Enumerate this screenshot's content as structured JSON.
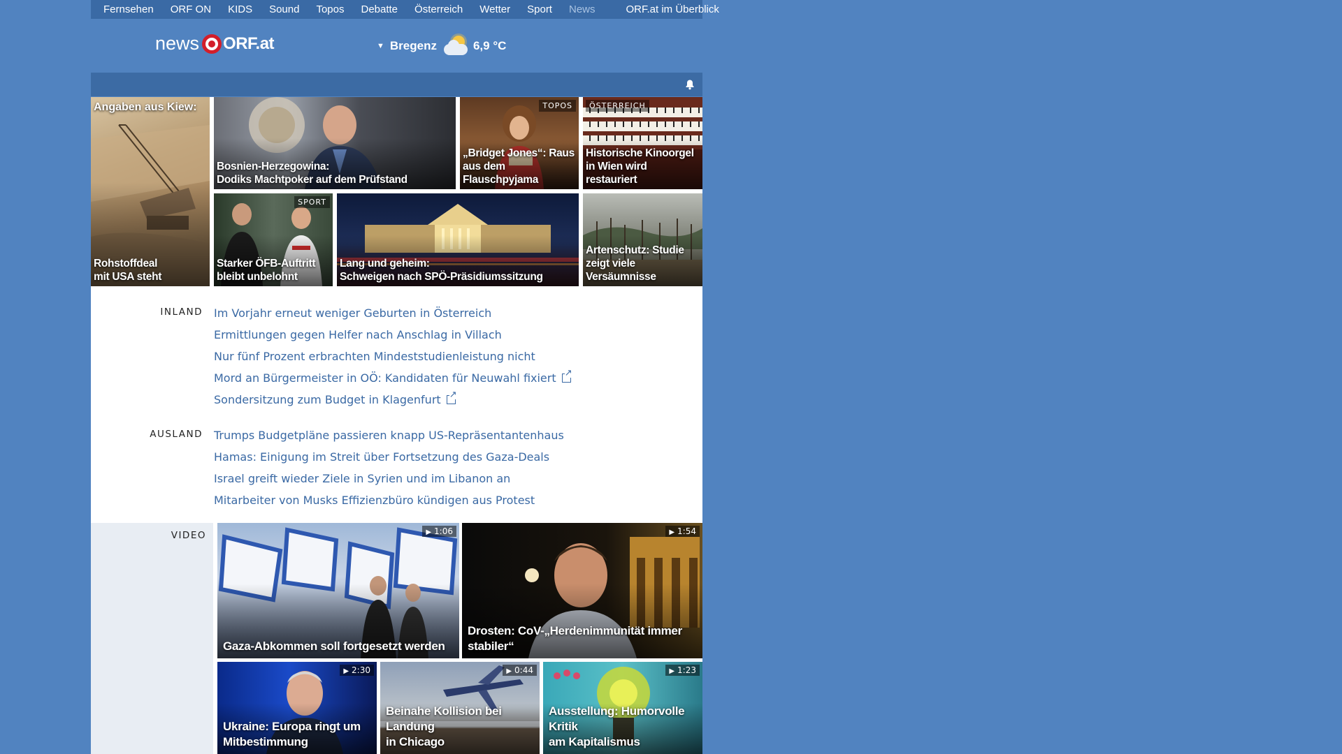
{
  "topnav": {
    "items": [
      "Fernsehen",
      "ORF ON",
      "KIDS",
      "Sound",
      "Topos",
      "Debatte",
      "Österreich",
      "Wetter",
      "Sport",
      "News"
    ],
    "overview": "ORF.at im Überblick"
  },
  "logo": {
    "news": "news",
    "orf": "ORF.at"
  },
  "weather": {
    "city": "Bregenz",
    "temperature": "6,9 °C",
    "icon": "partly-cloudy-icon"
  },
  "tiles": [
    {
      "top_label": "Angaben aus Kiew:",
      "caption": "Rohstoffdeal\nmit USA steht"
    },
    {
      "caption": "Bosnien-Herzegowina:\nDodiks Machtpoker auf dem Prüfstand"
    },
    {
      "tag": "TOPOS",
      "caption": "„Bridget Jones“: Raus\naus dem Flauschpyjama"
    },
    {
      "tag": "ÖSTERREICH",
      "caption": "Historische Kinoorgel\nin Wien wird restauriert"
    },
    {
      "tag": "SPORT",
      "caption": "Starker ÖFB-Auftritt\nbleibt unbelohnt"
    },
    {
      "caption": "Lang und geheim:\nSchweigen nach SPÖ-Präsidiumssitzung"
    },
    {
      "caption": "Artenschutz: Studie\nzeigt viele Versäumnisse"
    }
  ],
  "inland": {
    "label": "INLAND",
    "items": [
      "Im Vorjahr erneut weniger Geburten in Österreich",
      "Ermittlungen gegen Helfer nach Anschlag in Villach",
      "Nur fünf Prozent erbrachten Mindeststudienleistung nicht",
      "Mord an Bürgermeister in OÖ: Kandidaten für Neuwahl fixiert",
      "Sondersitzung zum Budget in Klagenfurt"
    ]
  },
  "ausland": {
    "label": "AUSLAND",
    "items": [
      "Trumps Budgetpläne passieren knapp US-Repräsentantenhaus",
      "Hamas: Einigung im Streit über Fortsetzung des Gaza-Deals",
      "Israel greift wieder Ziele in Syrien und im Libanon an",
      "Mitarbeiter von Musks Effizienzbüro kündigen aus Protest"
    ]
  },
  "video": {
    "label": "VIDEO",
    "items": [
      {
        "duration": "1:06",
        "caption": "Gaza-Abkommen soll fortgesetzt werden"
      },
      {
        "duration": "1:54",
        "caption": "Drosten: CoV-„Herdenimmunität immer\nstabiler“"
      },
      {
        "duration": "2:30",
        "caption": "Ukraine: Europa ringt um\nMitbestimmung"
      },
      {
        "duration": "0:44",
        "caption": "Beinahe Kollision bei Landung\nin Chicago"
      },
      {
        "duration": "1:23",
        "caption": "Ausstellung: Humorvolle Kritik\nam Kapitalismus"
      }
    ]
  },
  "colors": {
    "background": "#5183c0",
    "nav": "#3a6aa5",
    "link": "#3a69a4",
    "brand_red": "#d31e2a"
  }
}
